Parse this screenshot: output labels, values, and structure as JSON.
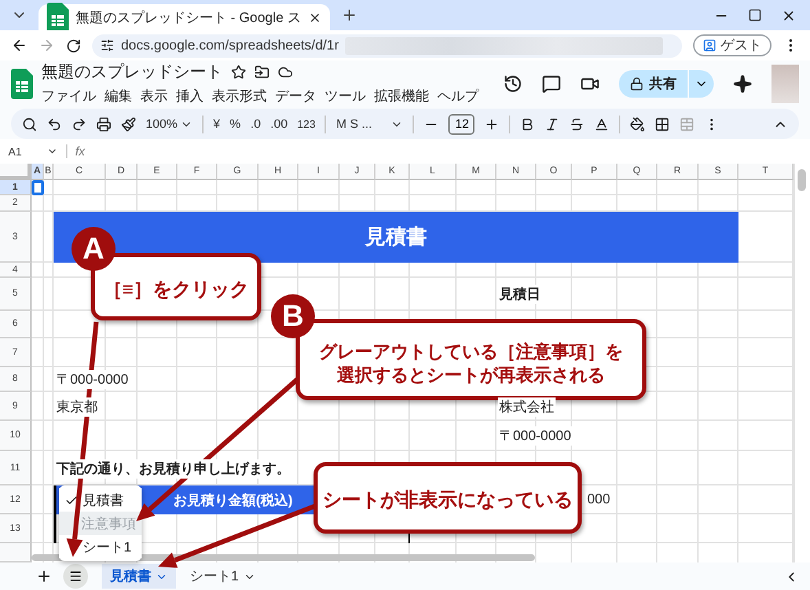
{
  "browser": {
    "tab_title": "無題のスプレッドシート - Google ス",
    "url": "docs.google.com/spreadsheets/d/1r",
    "profile": "ゲスト"
  },
  "doc": {
    "title": "無題のスプレッドシート",
    "menus": [
      "ファイル",
      "編集",
      "表示",
      "挿入",
      "表示形式",
      "データ",
      "ツール",
      "拡張機能",
      "ヘルプ"
    ],
    "share": "共有"
  },
  "toolbar": {
    "zoom": "100%",
    "currency": "¥",
    "percent": "%",
    "decrease_decimal": ".0",
    "increase_decimal": ".00",
    "number_format": "123",
    "font": "M S ...",
    "font_size": "12"
  },
  "formula_bar": {
    "cell_ref": "A1",
    "fx": "fx"
  },
  "sheet": {
    "columns": [
      {
        "label": "A",
        "selected": true
      },
      {
        "label": "B",
        "selected": false
      },
      {
        "label": "C",
        "selected": false
      },
      {
        "label": "D",
        "selected": false
      },
      {
        "label": "E",
        "selected": false
      },
      {
        "label": "F",
        "selected": false
      },
      {
        "label": "G",
        "selected": false
      },
      {
        "label": "H",
        "selected": false
      },
      {
        "label": "I",
        "selected": false
      },
      {
        "label": "J",
        "selected": false
      },
      {
        "label": "K",
        "selected": false
      },
      {
        "label": "L",
        "selected": false
      },
      {
        "label": "M",
        "selected": false
      },
      {
        "label": "N",
        "selected": false
      },
      {
        "label": "O",
        "selected": false
      },
      {
        "label": "P",
        "selected": false
      },
      {
        "label": "Q",
        "selected": false
      },
      {
        "label": "R",
        "selected": false
      },
      {
        "label": "S",
        "selected": false
      },
      {
        "label": "T",
        "selected": false
      }
    ],
    "rows": [
      {
        "label": "1",
        "selected": true
      },
      {
        "label": "2",
        "selected": false
      },
      {
        "label": "3",
        "selected": false
      },
      {
        "label": "4",
        "selected": false
      },
      {
        "label": "5",
        "selected": false
      },
      {
        "label": "6",
        "selected": false
      },
      {
        "label": "7",
        "selected": false
      },
      {
        "label": "8",
        "selected": false
      },
      {
        "label": "9",
        "selected": false
      },
      {
        "label": "10",
        "selected": false
      },
      {
        "label": "11",
        "selected": false
      },
      {
        "label": "12",
        "selected": false
      },
      {
        "label": "13",
        "selected": false
      }
    ],
    "banner": "見積書",
    "date_label": "見積日",
    "postal_left": "〒000-0000",
    "address": "東京都",
    "company": "株式会社",
    "postal_right": "〒000-0000",
    "greeting": "下記の通り、お見積り申し上げます。",
    "amount_header": "お見積り金額(税込)",
    "amount_fragment": "000"
  },
  "sheet_menu": [
    {
      "label": "見積書",
      "checked": true,
      "hidden": false,
      "highlighted": false
    },
    {
      "label": "注意事項",
      "checked": false,
      "hidden": true,
      "highlighted": true
    },
    {
      "label": "シート1",
      "checked": false,
      "hidden": false,
      "highlighted": false
    }
  ],
  "sheet_tabs": [
    {
      "label": "見積書",
      "selected": true
    },
    {
      "label": "シート1",
      "selected": false
    }
  ],
  "callouts": [
    {
      "badge": "A",
      "lines": [
        "［≡］をクリック"
      ]
    },
    {
      "badge": "B",
      "lines": [
        "グレーアウトしている［注意事項］を",
        "選択するとシートが再表示される"
      ]
    },
    {
      "lines": [
        "シートが非表示になっている"
      ]
    }
  ]
}
